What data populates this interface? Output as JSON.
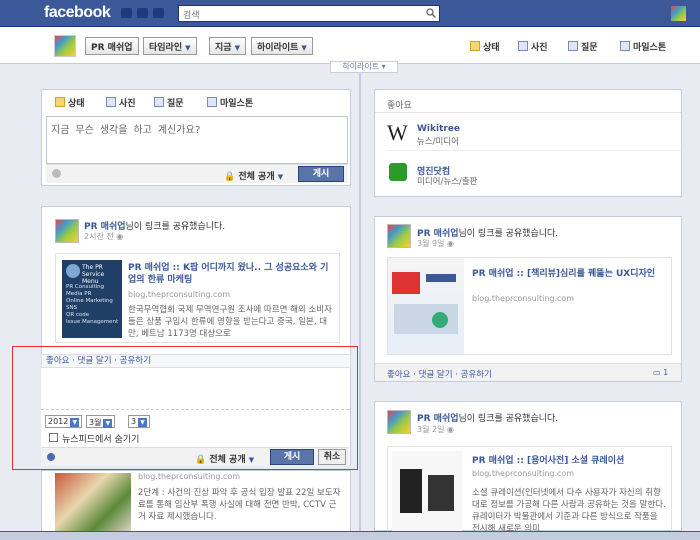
{
  "topbar": {
    "logo": "facebook",
    "search_placeholder": "검색"
  },
  "nav": {
    "buttons": [
      {
        "label": "PR 매쉬업",
        "caret": false
      },
      {
        "label": "타임라인",
        "caret": true
      },
      {
        "label": "지금",
        "caret": true
      },
      {
        "label": "하이라이트",
        "caret": true
      }
    ],
    "right": [
      "상태",
      "사진",
      "질문",
      "마일스톤"
    ],
    "timeline_label": "하이라이트 ▾"
  },
  "composer": {
    "tabs": [
      "상태",
      "사진",
      "질문",
      "마일스톤"
    ],
    "placeholder": "지금 무슨 생각을 하고 계신가요?",
    "privacy": "전체 공개",
    "post": "게시"
  },
  "likes": {
    "header": "좋아요",
    "items": [
      {
        "name": "Wikitree",
        "category": "뉴스/미디어"
      },
      {
        "name": "영진닷컴",
        "category": "미디어/뉴스/출판"
      }
    ]
  },
  "post1": {
    "author": "PR 매쉬업",
    "action": "님이 링크를 공유했습니다.",
    "time": "2시간 전",
    "title": "PR 매쉬업 :: K팝 어디까지 왔나.. 그 성공요소와 기업의 한류 마케팅",
    "url": "blog.theprconsulting.com",
    "desc": "한국무역협회 국제 무역연구원 조사에 따르면 해외 소비자들은 상품 구입시 한류에 영향을 받는다고 중국, 일본, 대만, 베트남 1173명 대상으로",
    "thumb_header": "The PR Service Menu",
    "thumb_lines": [
      "PR Consulting",
      "Media PR",
      "Online Marketing",
      "SNS",
      "QR code",
      "Issue Management"
    ],
    "actions": "좋아요 · 댓글 달기 · 공유하기"
  },
  "post2": {
    "author": "PR 매쉬업",
    "action": "님이 링크를 공유했습니다.",
    "time": "3월 9일",
    "title": "PR 매쉬업 :: [책리뷰]심리를 꿰뚫는 UX디자인",
    "url": "blog.theprconsulting.com",
    "actions": "좋아요 · 댓글 달기 · 공유하기",
    "comment_count": "1"
  },
  "post3": {
    "author": "PR 매쉬업",
    "action": "님이 링크를 공유했습니다.",
    "time": "3월 2일",
    "title": "PR 매쉬업 :: [용어사전] 소셜 큐레이션",
    "url": "blog.theprconsulting.com",
    "desc": "소셜 큐레이션(인터넷에서 다수 사용자가 자신의 취향대로 정보를 가공해 다른 사람과 공유하는 것을 말한다.큐레이터가 박물관에서 기준과 다른 방식으로 작품을 전시해 새로운 의미"
  },
  "post4": {
    "url": "blog.theprconsulting.com",
    "desc": "2단계 : 사건의 진상 파악 후 공식 입장 발표 22일 보도자료를 통해 임산부 폭행 사실에 대해 전면 반박, CCTV 근거 자료 제시했습니다."
  },
  "date_editor": {
    "year": "2012",
    "month": "3월",
    "day": "3",
    "hide_label": "뉴스피드에서 숨기기",
    "privacy": "전체 공개",
    "post": "게시",
    "cancel": "취소"
  },
  "colors": {
    "brand": "#3b5998",
    "highlight_box": "#e03030"
  }
}
